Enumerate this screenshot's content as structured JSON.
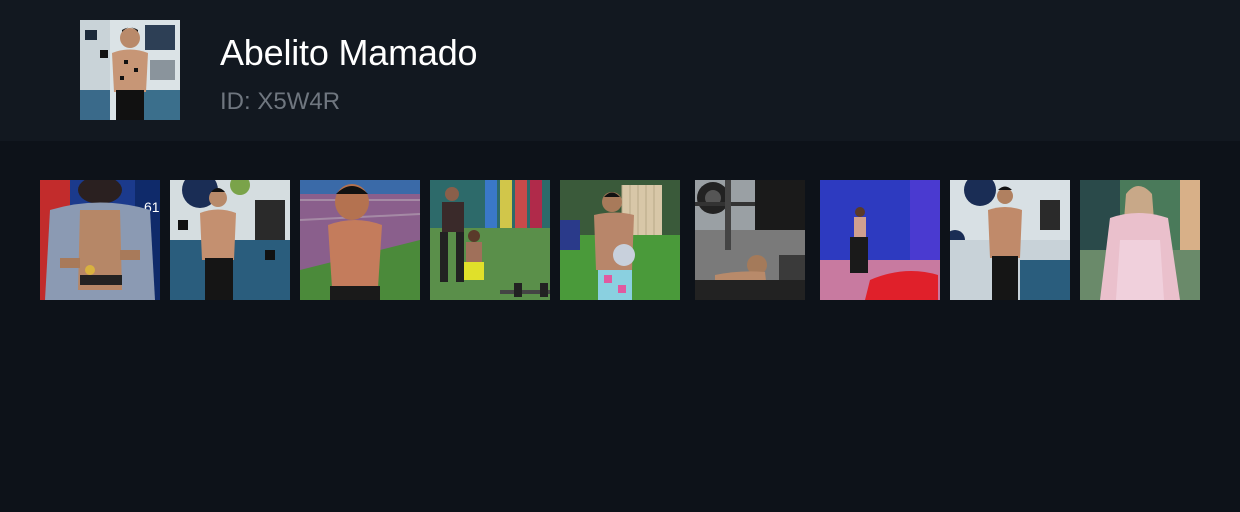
{
  "profile": {
    "name": "Abelito Mamado",
    "id_text": "ID: X5W4R",
    "avatar_icon": "profile-photo-shirtless-man"
  },
  "thumbnails": [
    {
      "label": "man unbuttoning shirt"
    },
    {
      "label": "shirtless man in kitchen"
    },
    {
      "label": "shirtless man on deck"
    },
    {
      "label": "training in yard"
    },
    {
      "label": "kettlebell lift"
    },
    {
      "label": "bench press"
    },
    {
      "label": "woman in blue room"
    },
    {
      "label": "shirtless man in kitchen 2"
    },
    {
      "label": "woman in pink robe"
    }
  ],
  "colors": {
    "page_bg": "#0d1219",
    "header_bg": "#121820",
    "name": "#ffffff",
    "id": "#6f767f"
  }
}
